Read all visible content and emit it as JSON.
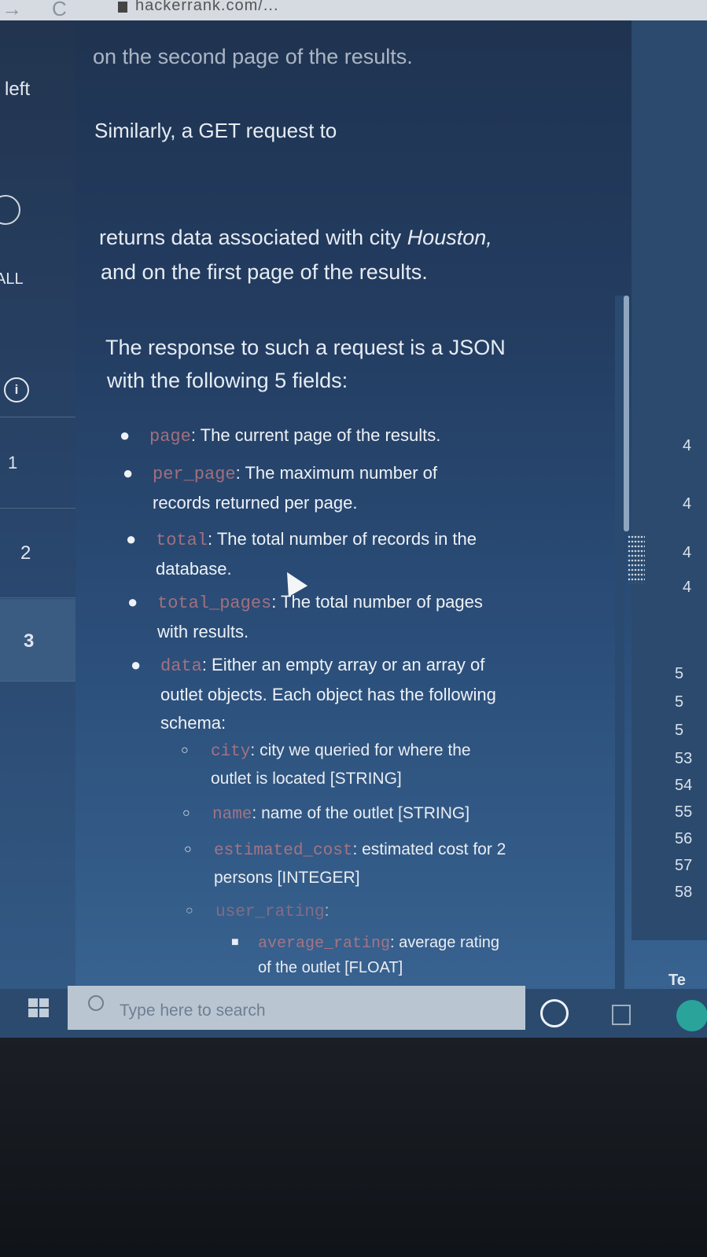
{
  "browser": {
    "url": "hackerrank.com/...",
    "nav_arrow": "→",
    "reload": "C"
  },
  "left_panel": {
    "label_left": "left",
    "label_all": "ALL",
    "items": [
      "1",
      "2",
      "3"
    ]
  },
  "content": {
    "line1": "on the second page of the results.",
    "line2": "Similarly, a GET request to",
    "line3a": "returns data associated with city ",
    "line3b": "Houston,",
    "line4": "and on the first page of the results.",
    "line5": "The response to such a request is a JSON",
    "line6": "with the following 5 fields:",
    "fields": [
      {
        "name": "page",
        "desc": ": The current page of the results."
      },
      {
        "name": "per_page",
        "desc": ": The maximum number of",
        "desc2": "records returned per page."
      },
      {
        "name": "total",
        "desc": ": The total number of records in the",
        "desc2": "database."
      },
      {
        "name": "total_pages",
        "desc": ": The total number of pages",
        "desc2": "with results."
      },
      {
        "name": "data",
        "desc": ": Either an empty array or an array of",
        "desc2": "outlet objects. Each object has the following",
        "desc3": "schema:"
      }
    ],
    "schema": [
      {
        "name": "city",
        "desc": ": city we queried for where the",
        "desc2": "outlet is located [STRING]"
      },
      {
        "name": "name",
        "desc": ": name of the outlet [STRING]"
      },
      {
        "name": "estimated_cost",
        "desc": ": estimated cost for 2",
        "desc2": "persons [INTEGER]"
      },
      {
        "name": "user_rating",
        "desc": ":"
      }
    ],
    "nested": {
      "name": "average_rating",
      "desc": ": average rating",
      "desc2": "of the outlet [FLOAT]"
    }
  },
  "right_panel": {
    "line_numbers": [
      "4",
      "4",
      "4",
      "4",
      "5",
      "5",
      "5",
      "53",
      "54",
      "55",
      "56",
      "57",
      "58"
    ],
    "te": "Te"
  },
  "taskbar": {
    "search_placeholder": "Type here to search"
  },
  "colors": {
    "code": "#c17a82",
    "panel": "#2b4a6e"
  }
}
